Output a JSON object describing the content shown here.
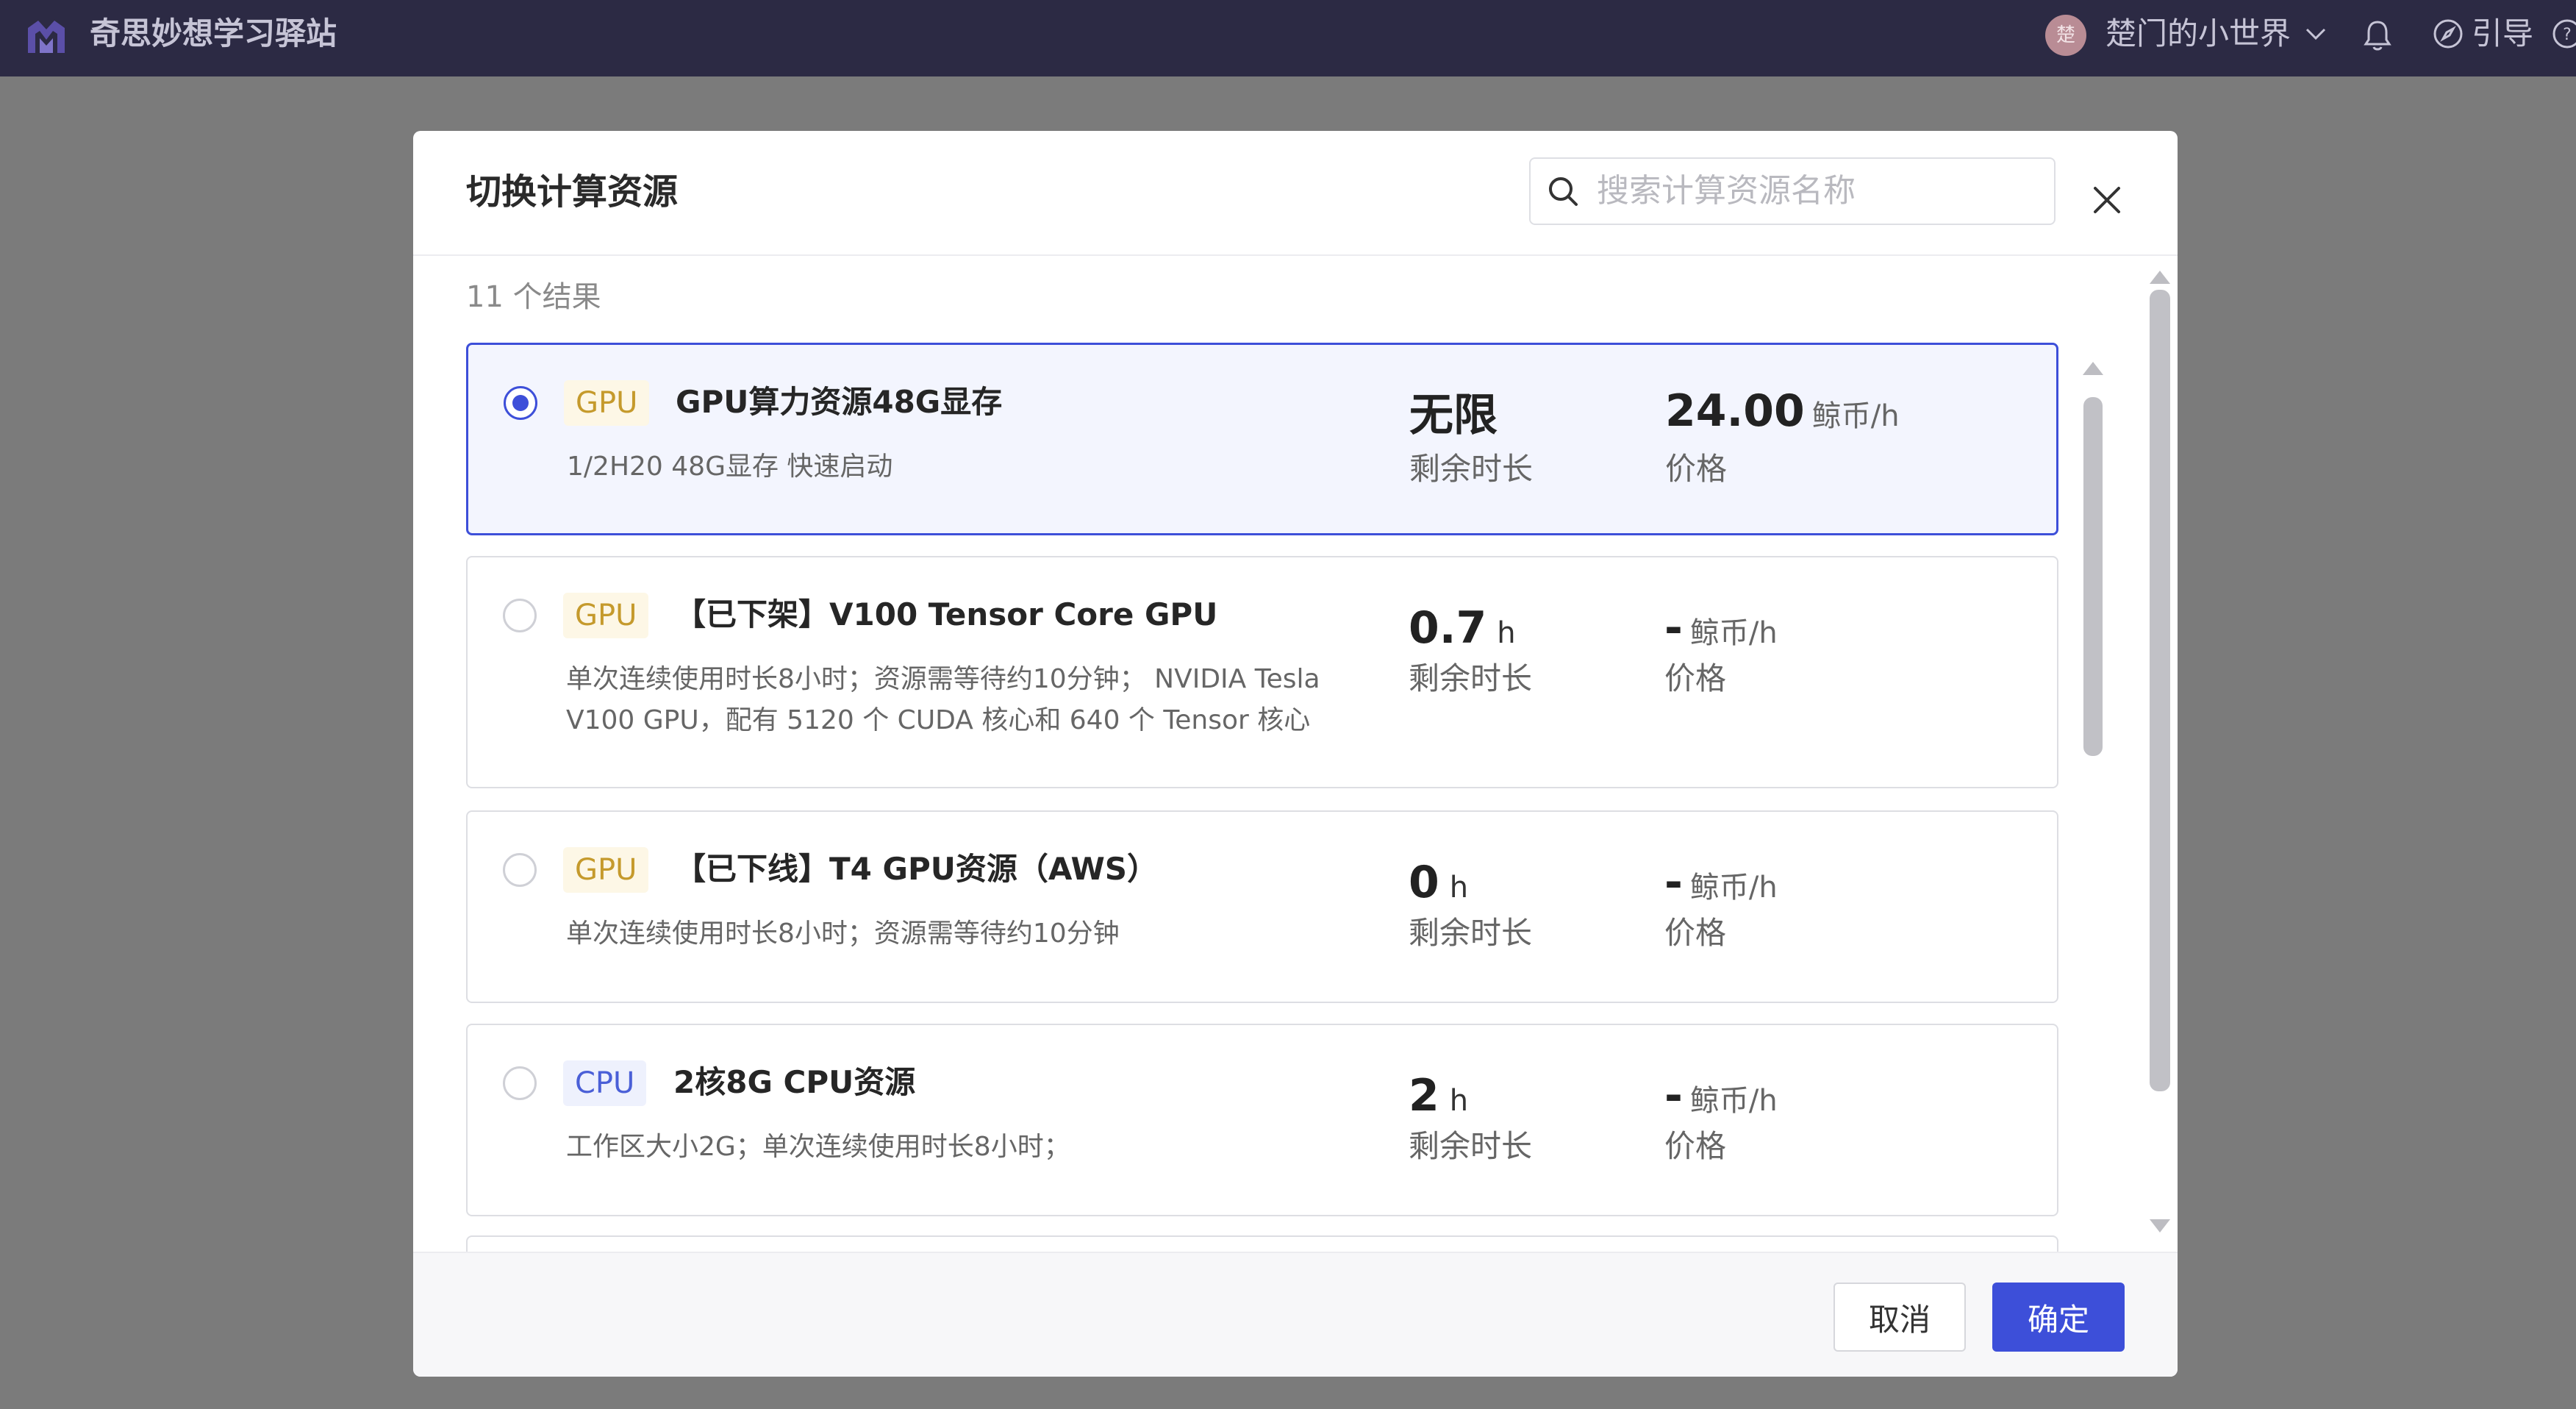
{
  "topbar": {
    "site_title": "奇思妙想学习驿站",
    "avatar_text": "楚",
    "user_name": "楚门的小世界",
    "guide_label": "引导",
    "bg_color": "#2c2a44"
  },
  "modal": {
    "title": "切换计算资源",
    "search": {
      "placeholder": "搜索计算资源名称",
      "value": ""
    },
    "result_count": "11 个结果",
    "remain_label": "剩余时长",
    "price_label": "价格",
    "price_unit": "鲸币/h",
    "items": [
      {
        "selected": true,
        "tag": "GPU",
        "name": "GPU算力资源48G显存",
        "desc": "1/2H20 48G显存 快速启动",
        "remain_value": "无限",
        "remain_unit": "",
        "price_value": "24.00"
      },
      {
        "selected": false,
        "tag": "GPU",
        "name": "【已下架】V100 Tensor Core GPU",
        "desc": "单次连续使用时长8小时；资源需等待约10分钟； NVIDIA Tesla V100 GPU，配有 5120 个 CUDA 核心和 640 个 Tensor 核心",
        "remain_value": "0.7",
        "remain_unit": "h",
        "price_value": "-"
      },
      {
        "selected": false,
        "tag": "GPU",
        "name": "【已下线】T4 GPU资源（AWS）",
        "desc": "单次连续使用时长8小时；资源需等待约10分钟",
        "remain_value": "0",
        "remain_unit": "h",
        "price_value": "-"
      },
      {
        "selected": false,
        "tag": "CPU",
        "name": "2核8G CPU资源",
        "desc": "工作区大小2G；单次连续使用时长8小时；",
        "remain_value": "2",
        "remain_unit": "h",
        "price_value": "-"
      }
    ],
    "cancel_label": "取消",
    "confirm_label": "确定",
    "accent_color": "#3d4fd9"
  }
}
